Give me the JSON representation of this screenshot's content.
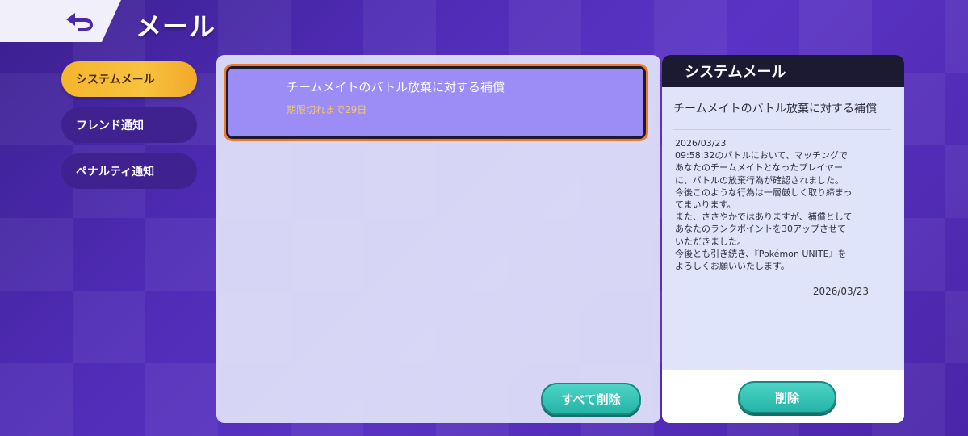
{
  "header": {
    "title": "メール",
    "back_icon": "back-arrow-icon"
  },
  "sidebar": {
    "tabs": [
      {
        "label": "システムメール",
        "active": true
      },
      {
        "label": "フレンド通知",
        "active": false
      },
      {
        "label": "ペナルティ通知",
        "active": false
      }
    ]
  },
  "mail_list": {
    "items": [
      {
        "title": "チームメイトのバトル放棄に対する補償",
        "expiry": "期限切れまで29日",
        "selected": true
      }
    ],
    "delete_all_label": "すべて削除"
  },
  "detail": {
    "header": "システムメール",
    "subject": "チームメイトのバトル放棄に対する補償",
    "message": "2026/03/23\n09:58:32のバトルにおいて、マッチングで\nあなたのチームメイトとなったプレイヤー\nに、バトルの放棄行為が確認されました。\n今後このような行為は一層厳しく取り締まっ\nてまいります。\nまた、ささやかではありますが、補償として\nあなたのランクポイントを30アップさせて\nいただきました。\n今後とも引き続き、『Pokémon UNITE』を\nよろしくお願いいたします。",
    "date": "2026/03/23",
    "delete_label": "削除"
  },
  "colors": {
    "accent_active_tab": "#f5b52d",
    "selected_border": "#f07a2c",
    "teal_button": "#22b2a4",
    "background": "#4f2bb5"
  }
}
